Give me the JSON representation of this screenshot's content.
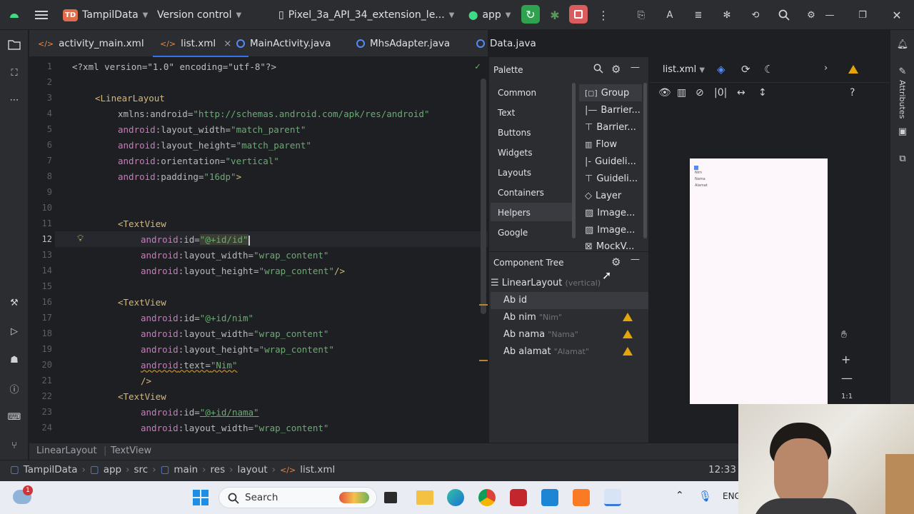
{
  "titlebar": {
    "project_badge": "TD",
    "project_name": "TampilData",
    "vcs": "Version control",
    "device": "Pixel_3a_API_34_extension_le...",
    "run_config": "app"
  },
  "tabs": [
    {
      "label": "activity_main.xml"
    },
    {
      "label": "list.xml",
      "close": "×"
    },
    {
      "label": "MainActivity.java"
    },
    {
      "label": "MhsAdapter.java"
    },
    {
      "label": "Data.java"
    }
  ],
  "editor": {
    "line_numbers": [
      "1",
      "2",
      "3",
      "4",
      "5",
      "6",
      "7",
      "8",
      "9",
      "10",
      "11",
      "12",
      "13",
      "14",
      "15",
      "16",
      "17",
      "18",
      "19",
      "20",
      "21",
      "22",
      "23",
      "24"
    ],
    "lines": {
      "l1": "<?xml version=\"1.0\" encoding=\"utf-8\"?>",
      "l3": "<LinearLayout",
      "l4_attr": "xmlns:android=",
      "l4_val": "\"http://schemas.android.com/apk/res/android\"",
      "l5_ns": "android",
      "l5_attr": ":layout_width=",
      "l5_val": "\"match_parent\"",
      "l6_ns": "android",
      "l6_attr": ":layout_height=",
      "l6_val": "\"match_parent\"",
      "l7_ns": "android",
      "l7_attr": ":orientation=",
      "l7_val": "\"vertical\"",
      "l8_ns": "android",
      "l8_attr": ":padding=",
      "l8_val": "\"16dp\"",
      "l8_end": ">",
      "l11": "<TextView",
      "l12_ns": "android",
      "l12_attr": ":id=",
      "l12_val": "\"@+id/id\"",
      "l13_ns": "android",
      "l13_attr": ":layout_width=",
      "l13_val": "\"wrap_content\"",
      "l14_ns": "android",
      "l14_attr": ":layout_height=",
      "l14_val": "\"wrap_content\"",
      "l14_end": "/>",
      "l16": "<TextView",
      "l17_ns": "android",
      "l17_attr": ":id=",
      "l17_val": "\"@+id/nim\"",
      "l18_ns": "android",
      "l18_attr": ":layout_width=",
      "l18_val": "\"wrap_content\"",
      "l19_ns": "android",
      "l19_attr": ":layout_height=",
      "l19_val": "\"wrap_content\"",
      "l20_ns": "android",
      "l20_attr": ":text=",
      "l20_val": "\"Nim\"",
      "l21": "/>",
      "l22": "<TextView",
      "l23_ns": "android",
      "l23_attr": ":id=",
      "l23_val": "\"@+id/nama\"",
      "l24_ns": "android",
      "l24_attr": ":layout_width=",
      "l24_val": "\"wrap_content\""
    }
  },
  "palette": {
    "title": "Palette",
    "categories": [
      "Common",
      "Text",
      "Buttons",
      "Widgets",
      "Layouts",
      "Containers",
      "Helpers",
      "Google"
    ],
    "selected_category": "Helpers",
    "items": [
      "Group",
      "Barrier...",
      "Barrier...",
      "Flow",
      "Guideli...",
      "Guideli...",
      "Layer",
      "Image...",
      "Image...",
      "MockV..."
    ]
  },
  "component_tree": {
    "title": "Component Tree",
    "root": {
      "label": "LinearLayout",
      "hint": "(vertical)"
    },
    "children": [
      {
        "prefix": "Ab",
        "label": "id",
        "hint": ""
      },
      {
        "prefix": "Ab",
        "label": "nim",
        "hint": "\"Nim\""
      },
      {
        "prefix": "Ab",
        "label": "nama",
        "hint": "\"Nama\""
      },
      {
        "prefix": "Ab",
        "label": "alamat",
        "hint": "\"Alamat\""
      }
    ]
  },
  "design": {
    "file_select": "list.xml",
    "attributes_label": "Attributes",
    "preview_texts": [
      "Nim",
      "Nama",
      "Alamat"
    ],
    "zoom_ratio": "1:1"
  },
  "breadcrumb_bottom": [
    "LinearLayout",
    "TextView"
  ],
  "status": {
    "path": [
      "TampilData",
      "app",
      "src",
      "main",
      "res",
      "layout",
      "list.xml"
    ],
    "position": "12:33"
  },
  "taskbar": {
    "search_placeholder": "Search",
    "notification_count": "1",
    "lang": "ENG"
  },
  "colors": {
    "accent": "#3574f0",
    "run_green": "#2fa14f",
    "stop_red": "#db5c5c",
    "warning": "#e5a50a"
  }
}
